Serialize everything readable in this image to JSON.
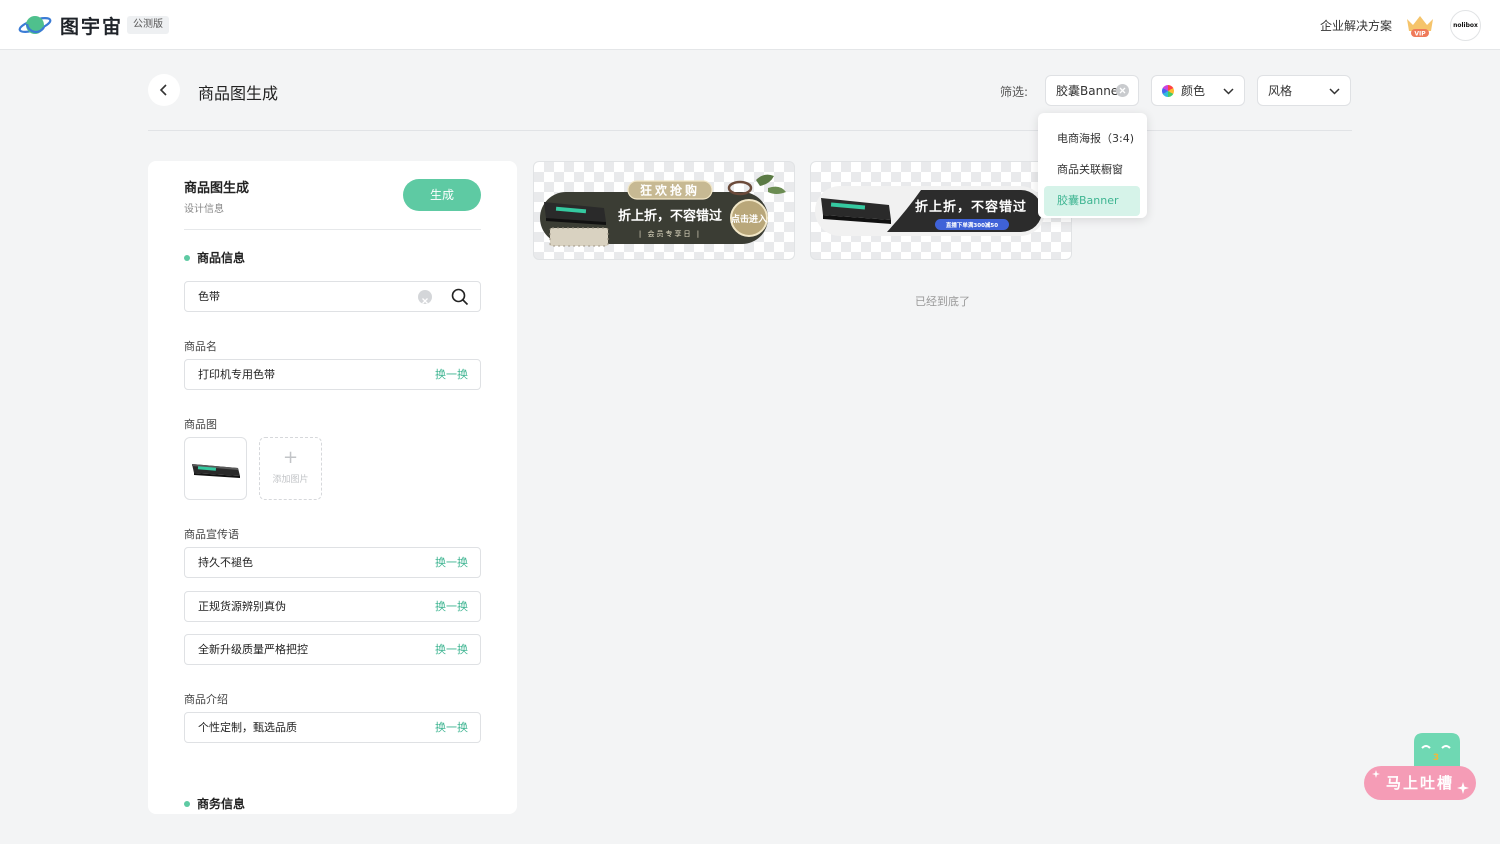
{
  "header": {
    "logo_text": "图宇宙",
    "beta_tag": "公测版",
    "enterprise_link": "企业解决方案",
    "vip_text": "VIP",
    "avatar_text": "nolibox"
  },
  "page": {
    "title": "商品图生成",
    "filter_label": "筛选:",
    "filters": {
      "type_value": "胶囊Banner",
      "color_label": "颜色",
      "style_label": "风格"
    },
    "type_options": [
      {
        "label": "电商海报（3:4)",
        "selected": false
      },
      {
        "label": "商品关联橱窗",
        "selected": false
      },
      {
        "label": "胶囊Banner",
        "selected": true
      }
    ]
  },
  "panel": {
    "title": "商品图生成",
    "subtitle": "设计信息",
    "generate_button": "生成",
    "section_product": "商品信息",
    "search_value": "色带",
    "name_label": "商品名",
    "name_value": "打印机专用色带",
    "swap_label": "换一换",
    "image_label": "商品图",
    "add_image_label": "添加图片",
    "slogan_label": "商品宣传语",
    "slogans": [
      "持久不褪色",
      "正规货源辨别真伪",
      "全新升级质量严格把控"
    ],
    "intro_label": "商品介绍",
    "intro_value": "个性定制，甄选品质",
    "section_business": "商务信息"
  },
  "results": [
    {
      "badge": "狂欢抢购",
      "headline": "折上折，不容错过",
      "sub": "| 会员专享日 |",
      "cta": "点击进入"
    },
    {
      "headline": "折上折，不容错过",
      "sub": "直播下单满300减50"
    }
  ],
  "end_text": "已经到底了",
  "feedback": {
    "label": "马上吐槽"
  },
  "colors": {
    "accent": "#5ecaa3",
    "accent_text": "#3fb592",
    "dropdown_selected_bg": "#d6f3e9",
    "feedback_pink": "#f59cb6"
  }
}
